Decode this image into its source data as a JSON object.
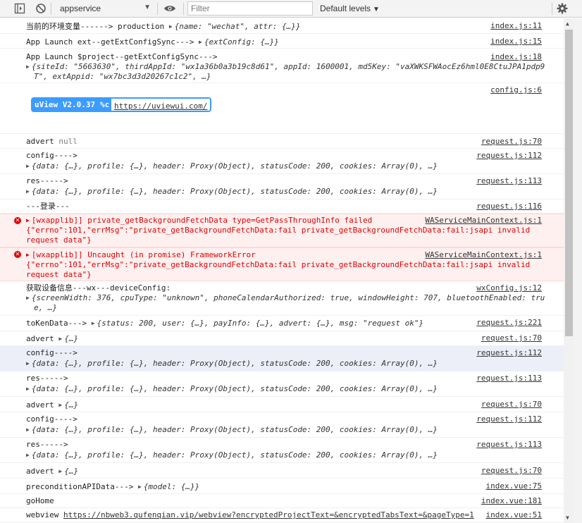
{
  "toolbar": {
    "context": "appservice",
    "filter_placeholder": "Filter",
    "levels": "Default levels"
  },
  "rows": [
    {
      "msg": "当前的环境变量------> production",
      "obj": "{name: \"wechat\", attr: {…}}",
      "src": "index.js:11"
    },
    {
      "msg": "App Launch ext--getExtConfigSync--->",
      "obj": "{extConfig: {…}}",
      "src": "index.js:15"
    },
    {
      "msg": "App Launch $project--getExtConfigSync--->",
      "l2": "{siteId: \"5663630\", thirdAppId: \"wx1a36b0a3b19c8d61\", appId: 1600001, md5Key: \"vaXWKSFWAocEz6hml0E8CtuJPA1pdp9",
      "l3": "T\", extAppid: \"wx7bc3d3d20267c1c2\", …}",
      "src": "index.js:18"
    },
    {
      "badge1": "uView V2.0.37",
      "badge_mid": "%c",
      "badge2": "https://uviewui.com/",
      "src": "config.js:6"
    },
    {
      "msg": "advert",
      "val": "null",
      "src": "request.js:70"
    },
    {
      "msg": "config---->",
      "l2": "{data: {…}, profile: {…}, header: Proxy(Object), statusCode: 200, cookies: Array(0), …}",
      "src": "request.js:112"
    },
    {
      "msg": "res----->",
      "l2": "{data: {…}, profile: {…}, header: Proxy(Object), statusCode: 200, cookies: Array(0), …}",
      "src": "request.js:113"
    },
    {
      "msg": "---登录---",
      "src": "request.js:116"
    },
    {
      "err": "[wxapplib]] private_getBackgroundFetchData type=GetPassThroughInfo failed",
      "l2": "{\"errno\":101,\"errMsg\":\"private_getBackgroundFetchData:fail private_getBackgroundFetchData:fail:jsapi invalid",
      "l3": "request data\"}",
      "src": "WAServiceMainContext.js:1"
    },
    {
      "err": "[wxapplib]] Uncaught (in promise) FrameworkError",
      "l2": "{\"errno\":101,\"errMsg\":\"private_getBackgroundFetchData:fail private_getBackgroundFetchData:fail:jsapi invalid",
      "l3": "request data\"}",
      "src": "WAServiceMainContext.js:1"
    },
    {
      "msg": "获取设备信息---wx---deviceConfig:",
      "l2": "{screenWidth: 376, cpuType: \"unknown\", phoneCalendarAuthorized: true, windowHeight: 707, bluetoothEnabled: tru",
      "l3": "e, …}",
      "src": "wxConfig.js:12"
    },
    {
      "msg": "toKenData--->",
      "obj": "{status: 200, user: {…}, payInfo: {…}, advert: {…}, msg: \"request ok\"}",
      "src": "request.js:221"
    },
    {
      "msg": "advert",
      "obj": "{…}",
      "src": "request.js:70"
    },
    {
      "msg": "config---->",
      "l2": "{data: {…}, profile: {…}, header: Proxy(Object), statusCode: 200, cookies: Array(0), …}",
      "src": "request.js:112"
    },
    {
      "msg": "res----->",
      "l2": "{data: {…}, profile: {…}, header: Proxy(Object), statusCode: 200, cookies: Array(0), …}",
      "src": "request.js:113"
    },
    {
      "msg": "advert",
      "obj": "{…}",
      "src": "request.js:70"
    },
    {
      "msg": "config---->",
      "l2": "{data: {…}, profile: {…}, header: Proxy(Object), statusCode: 200, cookies: Array(0), …}",
      "src": "request.js:112"
    },
    {
      "msg": "res----->",
      "l2": "{data: {…}, profile: {…}, header: Proxy(Object), statusCode: 200, cookies: Array(0), …}",
      "src": "request.js:113"
    },
    {
      "msg": "advert",
      "obj": "{…}",
      "src": "request.js:70"
    },
    {
      "msg": "preconditionAPIData--->",
      "obj": "{model: {…}}",
      "src": "index.vue:75"
    },
    {
      "msg": "goHome",
      "src": "index.vue:181"
    },
    {
      "msg": "webview",
      "link": "https://nbweb3.qufenqian.vip/webview?encryptedProjectText=&encryptedTabsText=&pageType=1",
      "src": "index.vue:51"
    }
  ]
}
